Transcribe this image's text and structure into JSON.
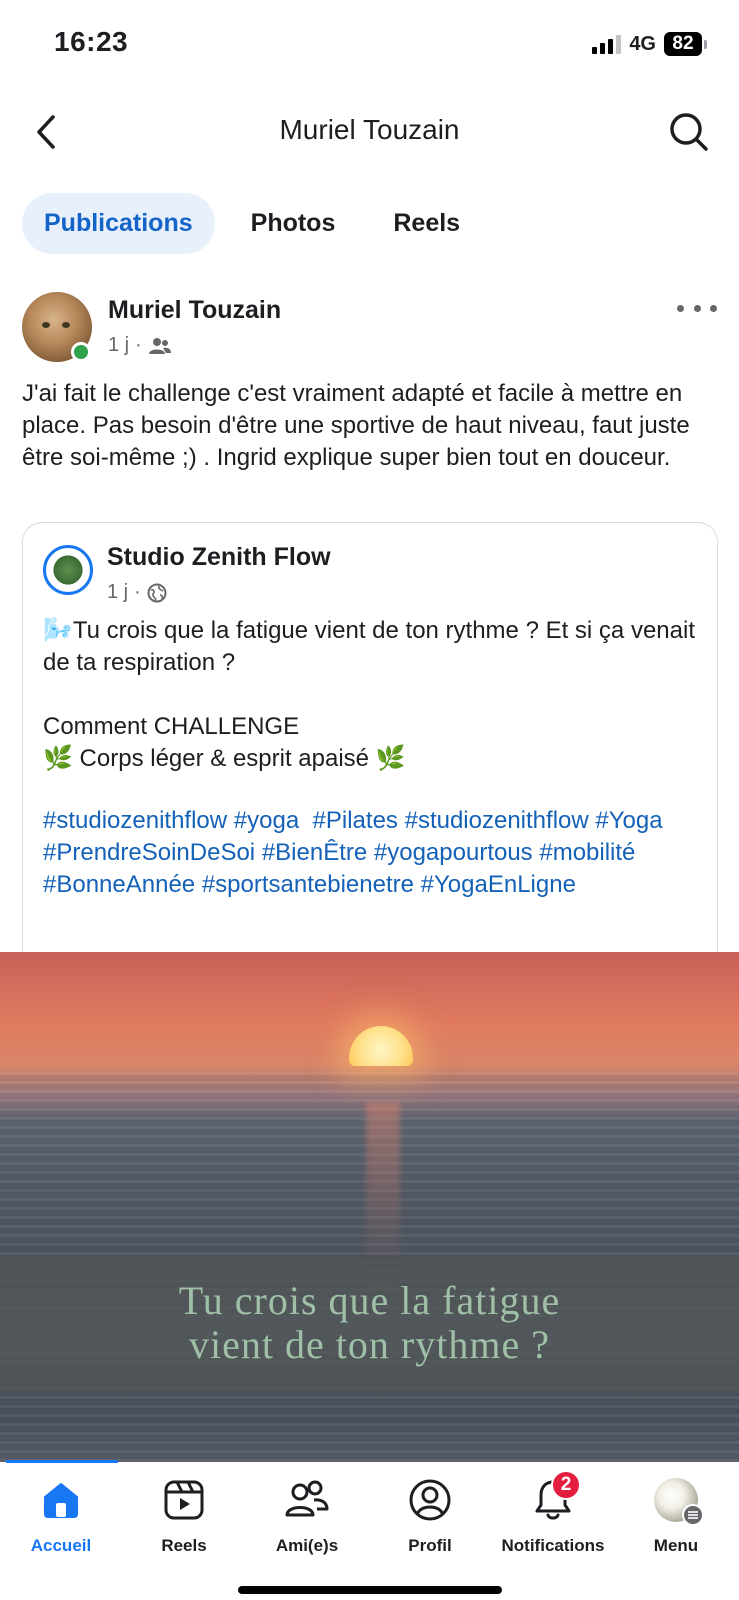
{
  "status_bar": {
    "time": "16:23",
    "network": "4G",
    "battery": "82"
  },
  "header": {
    "title": "Muriel Touzain"
  },
  "tabs": [
    {
      "label": "Publications",
      "active": true
    },
    {
      "label": "Photos",
      "active": false
    },
    {
      "label": "Reels",
      "active": false
    }
  ],
  "post": {
    "author": "Muriel Touzain",
    "time": "1 j",
    "audience_icon": "friends-icon",
    "text": "J'ai fait le challenge c'est vraiment adapté et facile à mettre en place. Pas besoin d'être une sportive de haut niveau, faut juste être soi-même ;) . Ingrid explique super bien tout en douceur."
  },
  "shared_post": {
    "author": "Studio Zenith Flow",
    "time": "1 j",
    "audience_icon": "globe-icon",
    "line1": "🌬️Tu crois que la fatigue vient de ton rythme ? Et si ça venait de ta respiration ?",
    "line2": "Comment CHALLENGE",
    "line3": "🌿  Corps léger & esprit apaisé 🌿",
    "hashtags": [
      "#studiozenithflow",
      "#yoga",
      "#Pilates",
      "#studiozenithflow",
      "#Yoga",
      "#PrendreSoinDeSoi",
      "#BienÊtre",
      "#yogapourtous",
      "#mobilité",
      "#BonneAnnée",
      "#sportsantebienetre",
      "#YogaEnLigne"
    ]
  },
  "video": {
    "caption_line1": "Tu crois que la fatigue",
    "caption_line2": "vient de ton rythme ?"
  },
  "bottom_nav": [
    {
      "label": "Accueil",
      "icon": "home-icon",
      "active": true
    },
    {
      "label": "Reels",
      "icon": "reels-icon",
      "active": false
    },
    {
      "label": "Ami(e)s",
      "icon": "friends-icon",
      "active": false
    },
    {
      "label": "Profil",
      "icon": "profile-icon",
      "active": false
    },
    {
      "label": "Notifications",
      "icon": "bell-icon",
      "active": false,
      "badge": "2"
    },
    {
      "label": "Menu",
      "icon": "menu-avatar",
      "active": false
    }
  ],
  "colors": {
    "accent": "#1877f2",
    "tab_active_bg": "#e7f0fb",
    "hashtag": "#1461b8",
    "online": "#31a24c",
    "badge": "#e41e3f"
  }
}
